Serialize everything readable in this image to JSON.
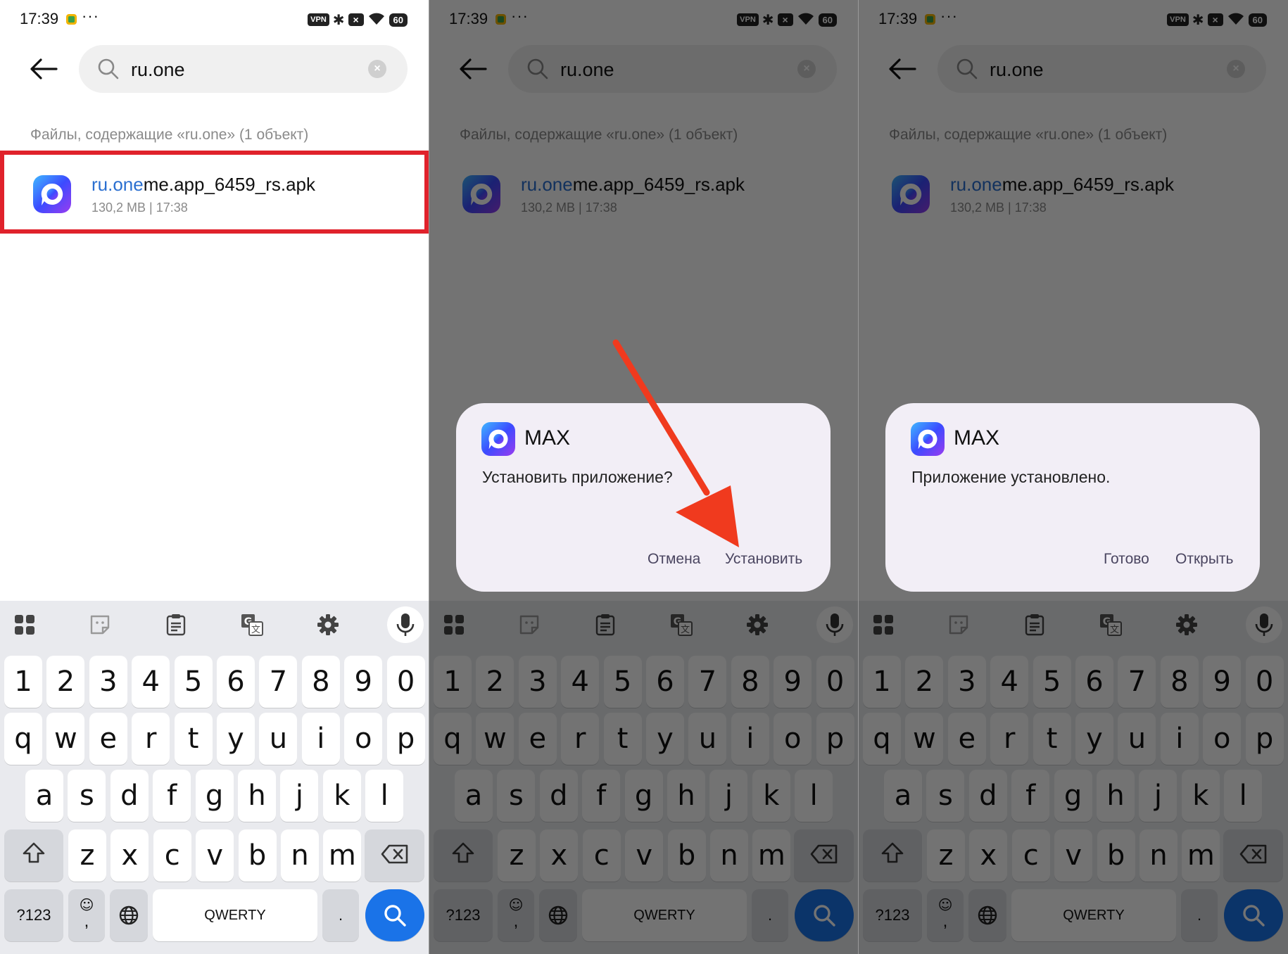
{
  "colors": {
    "accent": "#1a73e8",
    "highlight_border": "#e0222b",
    "match_text": "#2a6fd0",
    "arrow": "#f03a1e",
    "dialog_bg": "#f2eef6"
  },
  "status": {
    "time": "17:39",
    "dots": "···",
    "vpn": "VPN",
    "battery": "60"
  },
  "search": {
    "query": "ru.one",
    "clear": "×"
  },
  "results": {
    "caption": "Файлы, содержащие «ru.one» (1 объект)",
    "file": {
      "name_match": "ru.one",
      "name_rest": "me.app_6459_rs.apk",
      "meta": "130,2 MB  |  17:38"
    }
  },
  "keyboard": {
    "row1": [
      "1",
      "2",
      "3",
      "4",
      "5",
      "6",
      "7",
      "8",
      "9",
      "0"
    ],
    "row2": [
      "q",
      "w",
      "e",
      "r",
      "t",
      "y",
      "u",
      "i",
      "o",
      "p"
    ],
    "row3": [
      "a",
      "s",
      "d",
      "f",
      "g",
      "h",
      "j",
      "k",
      "l"
    ],
    "row4": [
      "z",
      "x",
      "c",
      "v",
      "b",
      "n",
      "m"
    ],
    "sym": "?123",
    "emoji_top": "☺",
    "emoji_bottom": ",",
    "space": "QWERTY",
    "period": "."
  },
  "dialogs": [
    {
      "app": "MAX",
      "message": "Установить приложение?",
      "secondary": "Отмена",
      "primary": "Установить"
    },
    {
      "app": "MAX",
      "message": "Приложение установлено.",
      "secondary": "Готово",
      "primary": "Открыть"
    }
  ]
}
